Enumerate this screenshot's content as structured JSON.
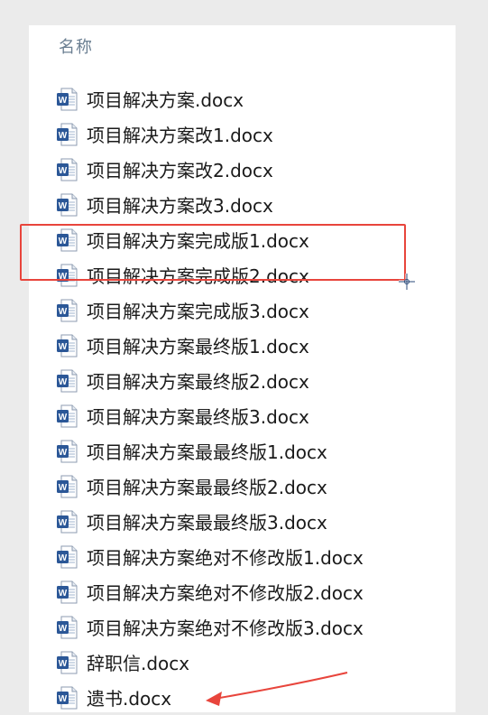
{
  "header": {
    "name_column": "名称"
  },
  "files": [
    "项目解决方案.docx",
    "项目解决方案改1.docx",
    "项目解决方案改2.docx",
    "项目解决方案改3.docx",
    "项目解决方案完成版1.docx",
    "项目解决方案完成版2.docx",
    "项目解决方案完成版3.docx",
    "项目解决方案最终版1.docx",
    "项目解决方案最终版2.docx",
    "项目解决方案最终版3.docx",
    "项目解决方案最最终版1.docx",
    "项目解决方案最最终版2.docx",
    "项目解决方案最最终版3.docx",
    "项目解决方案绝对不修改版1.docx",
    "项目解决方案绝对不修改版2.docx",
    "项目解决方案绝对不修改版3.docx",
    "辞职信.docx",
    "遗书.docx"
  ],
  "icons": {
    "file_icon": "word-document-icon"
  },
  "colors": {
    "annotation": "#e8453c",
    "word_blue": "#2b5797",
    "header_text": "#6b7f92"
  }
}
